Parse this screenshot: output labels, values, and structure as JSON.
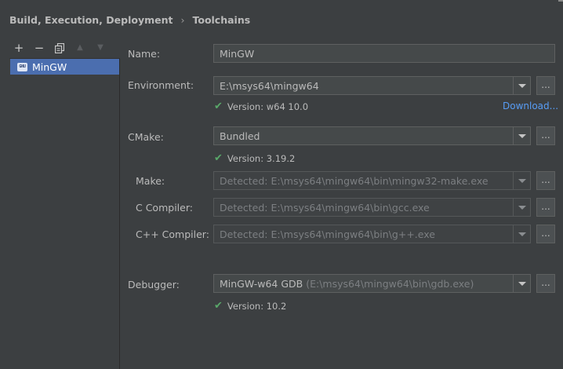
{
  "breadcrumb": {
    "section": "Build, Execution, Deployment",
    "separator": "›",
    "page": "Toolchains"
  },
  "toolbar": {
    "add": "+",
    "remove": "−",
    "copy": "⧉",
    "up": "▲",
    "down": "▼"
  },
  "toolchains": {
    "items": [
      {
        "label": "MinGW",
        "icon": "gnu-icon",
        "icon_text": "GNU"
      }
    ]
  },
  "form": {
    "name": {
      "label": "Name:",
      "value": "MinGW"
    },
    "environment": {
      "label": "Environment:",
      "value": "E:\\msys64\\mingw64",
      "version": "Version: w64 10.0",
      "download": "Download..."
    },
    "cmake": {
      "label": "CMake:",
      "value": "Bundled",
      "version": "Version: 3.19.2"
    },
    "make": {
      "label": "Make:",
      "value": "Detected: E:\\msys64\\mingw64\\bin\\mingw32-make.exe"
    },
    "c_compiler": {
      "label": "C Compiler:",
      "value": "Detected: E:\\msys64\\mingw64\\bin\\gcc.exe"
    },
    "cpp_compiler": {
      "label": "C++ Compiler:",
      "value": "Detected: E:\\msys64\\mingw64\\bin\\g++.exe"
    },
    "debugger": {
      "label": "Debugger:",
      "value": "MinGW-w64 GDB",
      "hint": "(E:\\msys64\\mingw64\\bin\\gdb.exe)",
      "version": "Version: 10.2"
    },
    "browse_label": "..."
  },
  "colors": {
    "background": "#3c3f41",
    "selection": "#4b6eaf",
    "link": "#589df6",
    "check": "#59a869"
  }
}
